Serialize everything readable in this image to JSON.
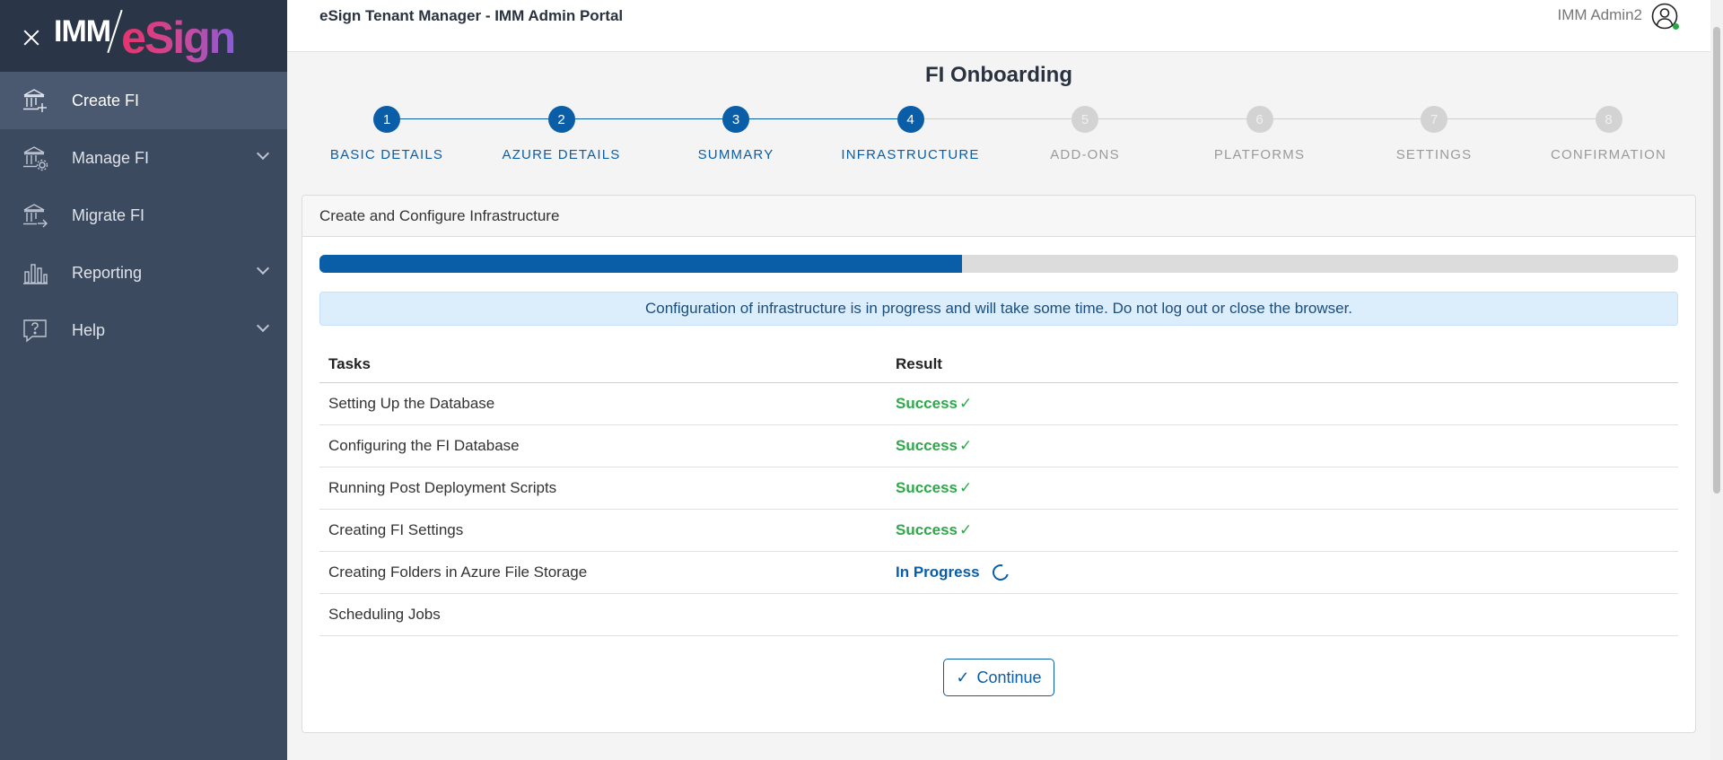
{
  "brand": {
    "imm": "IMM",
    "esign": "eSign"
  },
  "sidebar": {
    "items": [
      {
        "label": "Create FI",
        "icon": "bank-add-icon",
        "active": true,
        "expandable": false
      },
      {
        "label": "Manage FI",
        "icon": "bank-gear-icon",
        "active": false,
        "expandable": true
      },
      {
        "label": "Migrate FI",
        "icon": "bank-arrow-icon",
        "active": false,
        "expandable": false
      },
      {
        "label": "Reporting",
        "icon": "bar-chart-icon",
        "active": false,
        "expandable": true
      },
      {
        "label": "Help",
        "icon": "help-icon",
        "active": false,
        "expandable": true
      }
    ]
  },
  "header": {
    "title": "eSign Tenant Manager - IMM Admin Portal",
    "user": "IMM Admin2"
  },
  "page": {
    "title": "FI Onboarding"
  },
  "stepper": {
    "current": 4,
    "steps": [
      {
        "number": "1",
        "label": "BASIC DETAILS",
        "done": true
      },
      {
        "number": "2",
        "label": "AZURE DETAILS",
        "done": true
      },
      {
        "number": "3",
        "label": "SUMMARY",
        "done": true
      },
      {
        "number": "4",
        "label": "INFRASTRUCTURE",
        "done": true
      },
      {
        "number": "5",
        "label": "ADD-ONS",
        "done": false
      },
      {
        "number": "6",
        "label": "PLATFORMS",
        "done": false
      },
      {
        "number": "7",
        "label": "SETTINGS",
        "done": false
      },
      {
        "number": "8",
        "label": "CONFIRMATION",
        "done": false
      }
    ]
  },
  "card": {
    "header": "Create and Configure Infrastructure",
    "progress_percent": 47.3,
    "alert": "Configuration of infrastructure is in progress and will take some time. Do not log out or close the browser.",
    "table": {
      "col_task": "Tasks",
      "col_result": "Result",
      "rows": [
        {
          "task": "Setting Up the Database",
          "result": "Success",
          "status": "success"
        },
        {
          "task": "Configuring the FI Database",
          "result": "Success",
          "status": "success"
        },
        {
          "task": "Running Post Deployment Scripts",
          "result": "Success",
          "status": "success"
        },
        {
          "task": "Creating FI Settings",
          "result": "Success",
          "status": "success"
        },
        {
          "task": "Creating Folders in Azure File Storage",
          "result": "In Progress",
          "status": "progress"
        },
        {
          "task": "Scheduling Jobs",
          "result": "",
          "status": "pending"
        }
      ]
    },
    "continue_label": "Continue",
    "check_glyph": "✓"
  },
  "colors": {
    "primary": "#0a5ea8",
    "success": "#2ea84a",
    "sidebar": "#3c4a60",
    "inactive_step": "#d3d3d3"
  }
}
